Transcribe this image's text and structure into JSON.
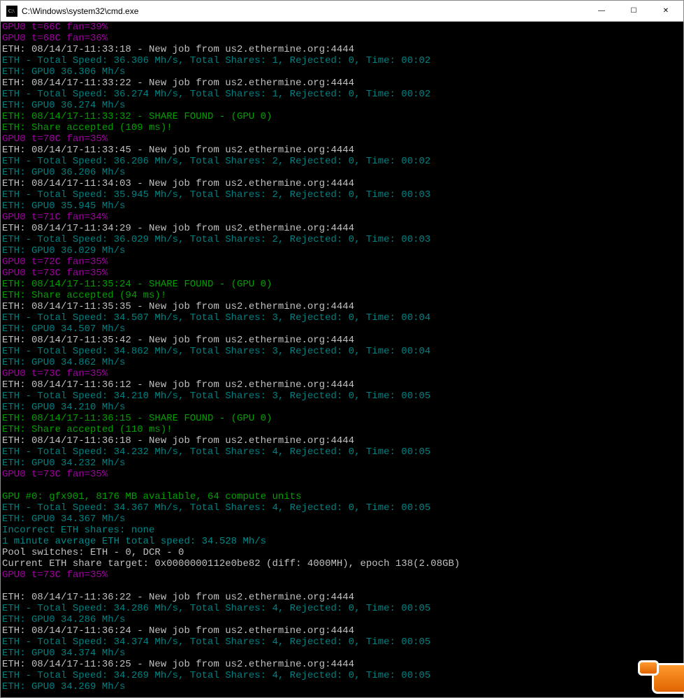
{
  "window": {
    "title": "C:\\Windows\\system32\\cmd.exe",
    "icon_name": "cmd-icon"
  },
  "titlebar_buttons": {
    "minimize": "—",
    "maximize": "☐",
    "close": "✕"
  },
  "colors": {
    "magenta": "#a000a0",
    "white": "#c0c0c0",
    "teal": "#008080",
    "green": "#00a000",
    "cyan": "#008888",
    "bg": "#000000"
  },
  "lines": [
    {
      "c": "magenta",
      "t": "GPU0 t=66C fan=39%"
    },
    {
      "c": "magenta",
      "t": "GPU0 t=68C fan=36%"
    },
    {
      "c": "white",
      "t": "ETH: 08/14/17-11:33:18 - New job from us2.ethermine.org:4444"
    },
    {
      "c": "teal",
      "t": "ETH - Total Speed: 36.306 Mh/s, Total Shares: 1, Rejected: 0, Time: 00:02"
    },
    {
      "c": "teal",
      "t": "ETH: GPU0 36.306 Mh/s"
    },
    {
      "c": "white",
      "t": "ETH: 08/14/17-11:33:22 - New job from us2.ethermine.org:4444"
    },
    {
      "c": "teal",
      "t": "ETH - Total Speed: 36.274 Mh/s, Total Shares: 1, Rejected: 0, Time: 00:02"
    },
    {
      "c": "teal",
      "t": "ETH: GPU0 36.274 Mh/s"
    },
    {
      "c": "green",
      "t": "ETH: 08/14/17-11:33:32 - SHARE FOUND - (GPU 0)"
    },
    {
      "c": "green",
      "t": "ETH: Share accepted (109 ms)!"
    },
    {
      "c": "magenta",
      "t": "GPU0 t=70C fan=35%"
    },
    {
      "c": "white",
      "t": "ETH: 08/14/17-11:33:45 - New job from us2.ethermine.org:4444"
    },
    {
      "c": "teal",
      "t": "ETH - Total Speed: 36.206 Mh/s, Total Shares: 2, Rejected: 0, Time: 00:02"
    },
    {
      "c": "teal",
      "t": "ETH: GPU0 36.206 Mh/s"
    },
    {
      "c": "white",
      "t": "ETH: 08/14/17-11:34:03 - New job from us2.ethermine.org:4444"
    },
    {
      "c": "teal",
      "t": "ETH - Total Speed: 35.945 Mh/s, Total Shares: 2, Rejected: 0, Time: 00:03"
    },
    {
      "c": "teal",
      "t": "ETH: GPU0 35.945 Mh/s"
    },
    {
      "c": "magenta",
      "t": "GPU0 t=71C fan=34%"
    },
    {
      "c": "white",
      "t": "ETH: 08/14/17-11:34:29 - New job from us2.ethermine.org:4444"
    },
    {
      "c": "teal",
      "t": "ETH - Total Speed: 36.029 Mh/s, Total Shares: 2, Rejected: 0, Time: 00:03"
    },
    {
      "c": "teal",
      "t": "ETH: GPU0 36.029 Mh/s"
    },
    {
      "c": "magenta",
      "t": "GPU0 t=72C fan=35%"
    },
    {
      "c": "magenta",
      "t": "GPU0 t=73C fan=35%"
    },
    {
      "c": "green",
      "t": "ETH: 08/14/17-11:35:24 - SHARE FOUND - (GPU 0)"
    },
    {
      "c": "green",
      "t": "ETH: Share accepted (94 ms)!"
    },
    {
      "c": "white",
      "t": "ETH: 08/14/17-11:35:35 - New job from us2.ethermine.org:4444"
    },
    {
      "c": "teal",
      "t": "ETH - Total Speed: 34.507 Mh/s, Total Shares: 3, Rejected: 0, Time: 00:04"
    },
    {
      "c": "teal",
      "t": "ETH: GPU0 34.507 Mh/s"
    },
    {
      "c": "white",
      "t": "ETH: 08/14/17-11:35:42 - New job from us2.ethermine.org:4444"
    },
    {
      "c": "teal",
      "t": "ETH - Total Speed: 34.862 Mh/s, Total Shares: 3, Rejected: 0, Time: 00:04"
    },
    {
      "c": "teal",
      "t": "ETH: GPU0 34.862 Mh/s"
    },
    {
      "c": "magenta",
      "t": "GPU0 t=73C fan=35%"
    },
    {
      "c": "white",
      "t": "ETH: 08/14/17-11:36:12 - New job from us2.ethermine.org:4444"
    },
    {
      "c": "teal",
      "t": "ETH - Total Speed: 34.210 Mh/s, Total Shares: 3, Rejected: 0, Time: 00:05"
    },
    {
      "c": "teal",
      "t": "ETH: GPU0 34.210 Mh/s"
    },
    {
      "c": "green",
      "t": "ETH: 08/14/17-11:36:15 - SHARE FOUND - (GPU 0)"
    },
    {
      "c": "green",
      "t": "ETH: Share accepted (110 ms)!"
    },
    {
      "c": "white",
      "t": "ETH: 08/14/17-11:36:18 - New job from us2.ethermine.org:4444"
    },
    {
      "c": "teal",
      "t": "ETH - Total Speed: 34.232 Mh/s, Total Shares: 4, Rejected: 0, Time: 00:05"
    },
    {
      "c": "teal",
      "t": "ETH: GPU0 34.232 Mh/s"
    },
    {
      "c": "magenta",
      "t": "GPU0 t=73C fan=35%"
    },
    {
      "c": "white",
      "t": ""
    },
    {
      "c": "green",
      "t": "GPU #0: gfx901, 8176 MB available, 64 compute units"
    },
    {
      "c": "teal",
      "t": "ETH - Total Speed: 34.367 Mh/s, Total Shares: 4, Rejected: 0, Time: 00:05"
    },
    {
      "c": "teal",
      "t": "ETH: GPU0 34.367 Mh/s"
    },
    {
      "c": "cyan",
      "t": "Incorrect ETH shares: none"
    },
    {
      "c": "cyan",
      "t": "1 minute average ETH total speed: 34.528 Mh/s"
    },
    {
      "c": "white",
      "t": "Pool switches: ETH - 0, DCR - 0"
    },
    {
      "c": "white",
      "t": "Current ETH share target: 0x0000000112e0be82 (diff: 4000MH), epoch 138(2.08GB)"
    },
    {
      "c": "magenta",
      "t": "GPU0 t=73C fan=35%"
    },
    {
      "c": "white",
      "t": ""
    },
    {
      "c": "white",
      "t": "ETH: 08/14/17-11:36:22 - New job from us2.ethermine.org:4444"
    },
    {
      "c": "teal",
      "t": "ETH - Total Speed: 34.286 Mh/s, Total Shares: 4, Rejected: 0, Time: 00:05"
    },
    {
      "c": "teal",
      "t": "ETH: GPU0 34.286 Mh/s"
    },
    {
      "c": "white",
      "t": "ETH: 08/14/17-11:36:24 - New job from us2.ethermine.org:4444"
    },
    {
      "c": "teal",
      "t": "ETH - Total Speed: 34.374 Mh/s, Total Shares: 4, Rejected: 0, Time: 00:05"
    },
    {
      "c": "teal",
      "t": "ETH: GPU0 34.374 Mh/s"
    },
    {
      "c": "white",
      "t": "ETH: 08/14/17-11:36:25 - New job from us2.ethermine.org:4444"
    },
    {
      "c": "teal",
      "t": "ETH - Total Speed: 34.269 Mh/s, Total Shares: 4, Rejected: 0, Time: 00:05"
    },
    {
      "c": "teal",
      "t": "ETH: GPU0 34.269 Mh/s"
    }
  ]
}
